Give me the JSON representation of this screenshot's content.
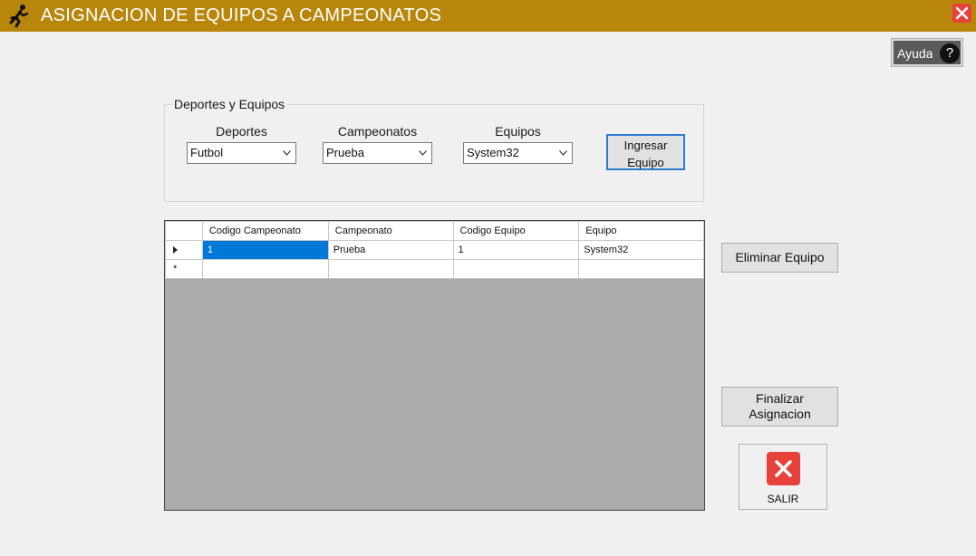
{
  "window": {
    "title": "ASIGNACION DE EQUIPOS A CAMPEONATOS",
    "app_icon": "running-person-icon",
    "close_icon": "close-icon",
    "colors": {
      "titlebar": "#b8860b",
      "close": "#e8413c",
      "selection": "#0078d7"
    }
  },
  "help": {
    "label": "Ayuda",
    "icon": "question-mark-icon",
    "glyph": "?"
  },
  "group": {
    "legend": "Deportes y Equipos",
    "fields": {
      "deportes": {
        "label": "Deportes",
        "value": "Futbol"
      },
      "campeonatos": {
        "label": "Campeonatos",
        "value": "Prueba"
      },
      "equipos": {
        "label": "Equipos",
        "value": "System32"
      }
    },
    "add_button": {
      "line1": "Ingresar",
      "line2": "Equipo"
    }
  },
  "grid": {
    "columns": [
      "Codigo Campeonato",
      "Campeonato",
      "Codigo Equipo",
      "Equipo"
    ],
    "rows": [
      {
        "codigo_campeonato": "1",
        "campeonato": "Prueba",
        "codigo_equipo": "1",
        "equipo": "System32"
      }
    ],
    "new_row_marker": "*"
  },
  "actions": {
    "eliminar": "Eliminar Equipo",
    "finalizar": {
      "line1": "Finalizar",
      "line2": "Asignacion"
    },
    "salir": "SALIR"
  }
}
